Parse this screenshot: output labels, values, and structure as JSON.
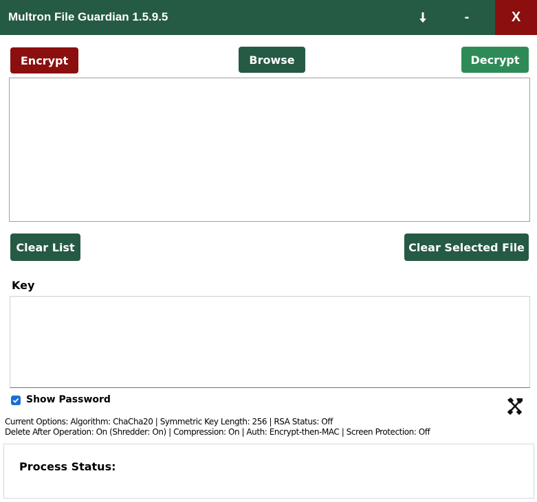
{
  "window": {
    "title": "Multron File Guardian 1.5.9.5",
    "download_glyph": "⬇",
    "minimize_glyph": "-",
    "close_glyph": "X"
  },
  "toolbar": {
    "encrypt_label": "Encrypt",
    "browse_label": "Browse",
    "decrypt_label": "Decrypt"
  },
  "file_list": {
    "items": []
  },
  "list_actions": {
    "clear_list_label": "Clear List",
    "clear_selected_label": "Clear Selected File"
  },
  "key": {
    "label": "Key",
    "value": ""
  },
  "show_password": {
    "label": "Show Password",
    "checked": true
  },
  "options": {
    "line1": "Current Options: Algorithm: ChaCha20 | Symmetric Key Length: 256 | RSA Status: Off",
    "line2": "Delete After Operation: On (Shredder: On) | Compression: On | Auth: Encrypt-then-MAC | Screen Protection: Off"
  },
  "status": {
    "label": "Process Status:"
  },
  "colors": {
    "primary_green": "#255a44",
    "light_green": "#2e8b57",
    "danger_red": "#8b0f0f",
    "checkbox_blue": "#1a6fd6"
  },
  "icons": {
    "download": "download-icon",
    "tools": "tools-icon"
  }
}
